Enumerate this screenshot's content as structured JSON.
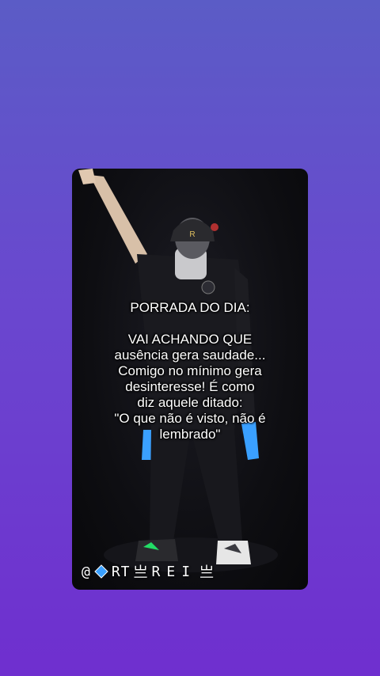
{
  "post": {
    "title": "PORRADA DO DIA:",
    "lines": [
      "VAI ACHANDO QUE",
      "ausência gera saudade...",
      "Comigo no mínimo gera",
      "desinteresse! É como",
      "diz aquele ditado:",
      "\"O que não é visto, não é",
      "lembrado\""
    ],
    "watermark": {
      "at": "@",
      "icon": "blue-diamond-icon",
      "brand": "RT",
      "sep1": "亗",
      "name": "REI",
      "sep2": "亗"
    }
  },
  "colors": {
    "bg_top": "#5b5cc6",
    "bg_bottom": "#6f2fcf",
    "card_bg": "#0e0e12",
    "accent_blue": "#3aa0ff",
    "sneaker_green": "#22dd66"
  }
}
